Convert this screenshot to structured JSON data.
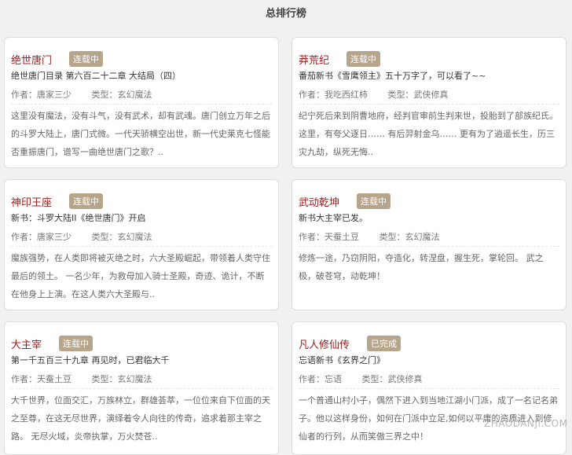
{
  "header": {
    "title": "总排行榜"
  },
  "cards": [
    {
      "name": "绝世唐门",
      "status": "连载中",
      "update": "绝世唐门目录 第六百二十二章 大结局（四）",
      "author_label": "作者：",
      "author": "唐家三少",
      "type_label": "类型：",
      "type": "玄幻魔法",
      "desc": "这里没有魔法，没有斗气，没有武术，却有武魂。唐门创立万年之后的斗罗大陆上，唐门式微。一代天骄横空出世，新一代史莱克七怪能否重振唐门，谱写一曲绝世唐门之歌？.."
    },
    {
      "name": "莽荒纪",
      "status": "连载中",
      "update": "番茄新书《雪鹰领主》五十万字了，可以看了~~",
      "author_label": "作者：",
      "author": "我吃西红柿",
      "type_label": "类型：",
      "type": "武侠修真",
      "desc": "纪宁死后来到阴曹地府，经判官审前生判来世，投胎到了部族纪氏。 这里，有夸父逐日…… 有后羿射金乌…… 更有为了逍遥长生，历三灾九劫，纵死无悔.."
    },
    {
      "name": "神印王座",
      "status": "连载中",
      "update": "新书：斗罗大陆II《绝世唐门》开启",
      "author_label": "作者：",
      "author": "唐家三少",
      "type_label": "类型：",
      "type": "玄幻魔法",
      "desc": "魔族强势，在人类即将被灭绝之时，六大圣殿崛起，带领着人类守住最后的领土。 一名少年，为救母加入骑士圣殿，奇迹、诡计，不断在他身上上演。在这人类六大圣殿与.."
    },
    {
      "name": "武动乾坤",
      "status": "连载中",
      "update": "新书大主宰已发。",
      "author_label": "作者：",
      "author": "天蚕土豆",
      "type_label": "类型：",
      "type": "玄幻魔法",
      "desc": "修炼一途，乃窃阴阳，夺造化，转涅盘，握生死，掌轮回。 武之极，破苍穹，动乾坤！"
    },
    {
      "name": "大主宰",
      "status": "连载中",
      "update": "第一千五百三十九章 再见时，已君临大千",
      "author_label": "作者：",
      "author": "天蚕土豆",
      "type_label": "类型：",
      "type": "玄幻魔法",
      "desc": "大千世界，位面交汇，万族林立，群雄荟萃，一位位来自下位面的天之至尊，在这无尽世界，演绎着令人向往的传奇，追求着那主宰之路。 无尽火域，炎帝执掌，万火焚苍.."
    },
    {
      "name": "凡人修仙传",
      "status": "已完成",
      "update": "忘语新书《玄界之门》",
      "author_label": "作者：",
      "author": "忘语",
      "type_label": "类型：",
      "type": "武侠修真",
      "desc": "一个普通山村小子，偶然下进入到当地江湖小门派，成了一名记名弟子。他以这样身份，如何在门派中立足,如何以平庸的资质进入到修仙者的行列，从而笑傲三界之中！"
    }
  ],
  "watermark": "ZHAODANJI.COM"
}
